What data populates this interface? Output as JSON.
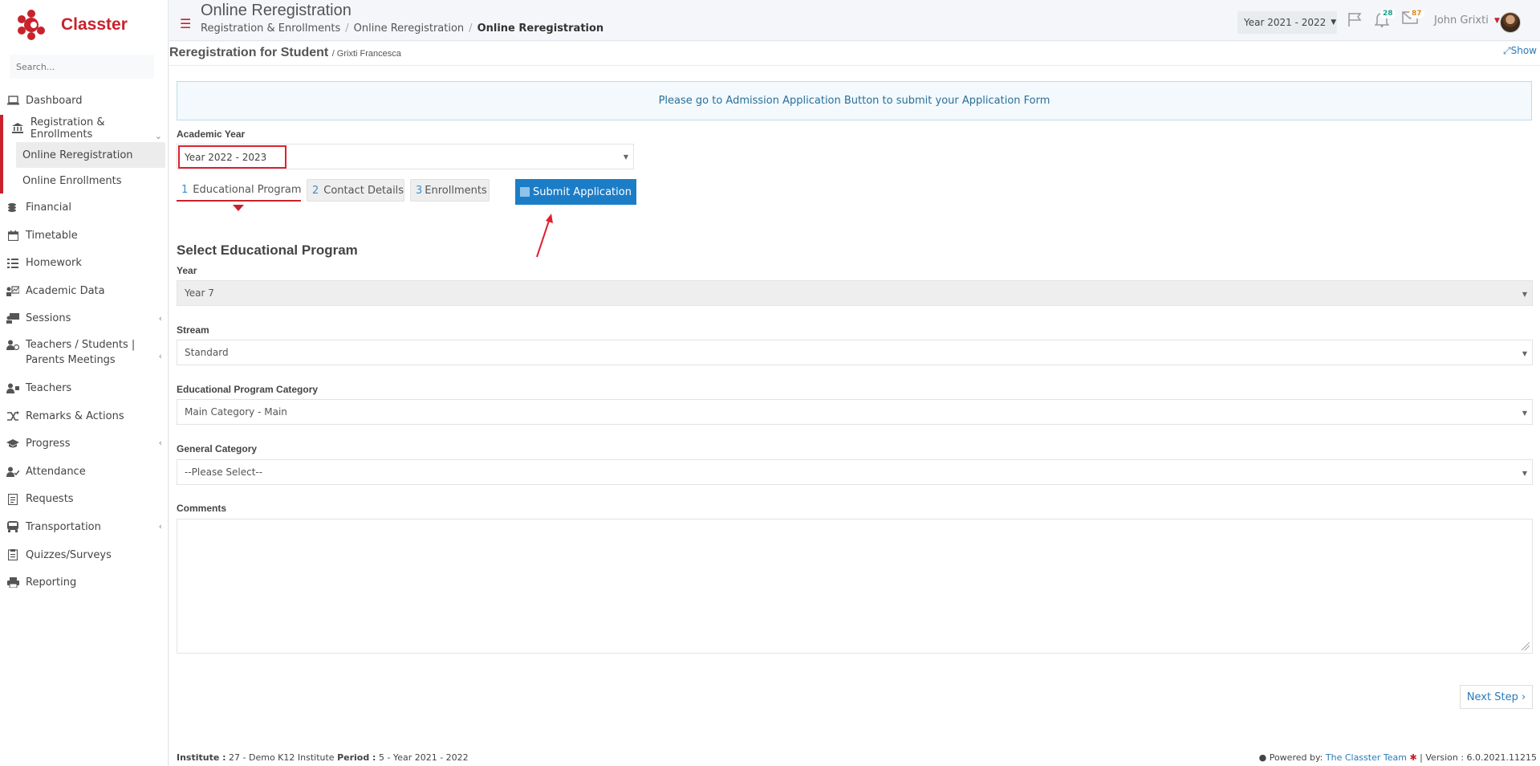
{
  "brand": {
    "name": "Classter",
    "color": "#c8222c"
  },
  "sidebar": {
    "search_placeholder": "Search...",
    "items": [
      {
        "label": "Dashboard",
        "icon": "laptop-icon"
      },
      {
        "label": "Registration & Enrollments",
        "icon": "institution-icon"
      },
      {
        "label": "Online Reregistration"
      },
      {
        "label": "Online Enrollments"
      },
      {
        "label": "Financial",
        "icon": "coins-icon"
      },
      {
        "label": "Timetable",
        "icon": "calendar-icon"
      },
      {
        "label": "Homework",
        "icon": "list-icon"
      },
      {
        "label": "Academic Data",
        "icon": "chart-icon"
      },
      {
        "label": "Sessions",
        "icon": "presentation-icon"
      },
      {
        "label": "Teachers / Students | Parents Meetings",
        "icon": "users-icon"
      },
      {
        "label": "Teachers",
        "icon": "teacher-icon"
      },
      {
        "label": "Remarks & Actions",
        "icon": "shuffle-icon"
      },
      {
        "label": "Progress",
        "icon": "graduation-cap-icon"
      },
      {
        "label": "Attendance",
        "icon": "user-check-icon"
      },
      {
        "label": "Requests",
        "icon": "document-icon"
      },
      {
        "label": "Transportation",
        "icon": "bus-icon"
      },
      {
        "label": "Quizzes/Surveys",
        "icon": "clipboard-icon"
      },
      {
        "label": "Reporting",
        "icon": "printer-icon"
      }
    ]
  },
  "header": {
    "title": "Online Reregistration",
    "breadcrumb": [
      "Registration & Enrollments",
      "Online Reregistration",
      "Online Reregistration"
    ],
    "year_select": "Year 2021 - 2022",
    "notifications_count": "28",
    "messages_count": "87",
    "user_name": "John Grixti"
  },
  "subheader": {
    "title": "Reregistration for Student",
    "student": "/ Grixti Francesca",
    "show_label": "Show"
  },
  "info_message": "Please go to Admission Application Button to submit your Application Form",
  "form": {
    "academic_year_label": "Academic Year",
    "academic_year_value": "Year 2022 - 2023",
    "tabs": [
      {
        "num": "1",
        "label": "Educational Program"
      },
      {
        "num": "2",
        "label": "Contact Details"
      },
      {
        "num": "3",
        "label": "Enrollments"
      }
    ],
    "submit_label": "Submit Application",
    "section_title": "Select Educational Program",
    "year_label": "Year",
    "year_value": "Year 7",
    "stream_label": "Stream",
    "stream_value": "Standard",
    "category_label": "Educational Program Category",
    "category_value": "Main Category - Main",
    "general_label": "General Category",
    "general_value": "--Please Select--",
    "comments_label": "Comments",
    "next_label": "Next Step"
  },
  "footer": {
    "institute_label": "Institute :",
    "institute_value": "27 - Demo K12 Institute",
    "period_label": "Period :",
    "period_value": "5 - Year 2021 - 2022",
    "powered_label": "Powered by:",
    "powered_link": "The Classter Team",
    "version": "| Version : 6.0.2021.11215"
  },
  "colors": {
    "accent": "#c8222c",
    "primary": "#1c7dc7",
    "link": "#2a7ab8",
    "highlight": "#e0202e"
  }
}
